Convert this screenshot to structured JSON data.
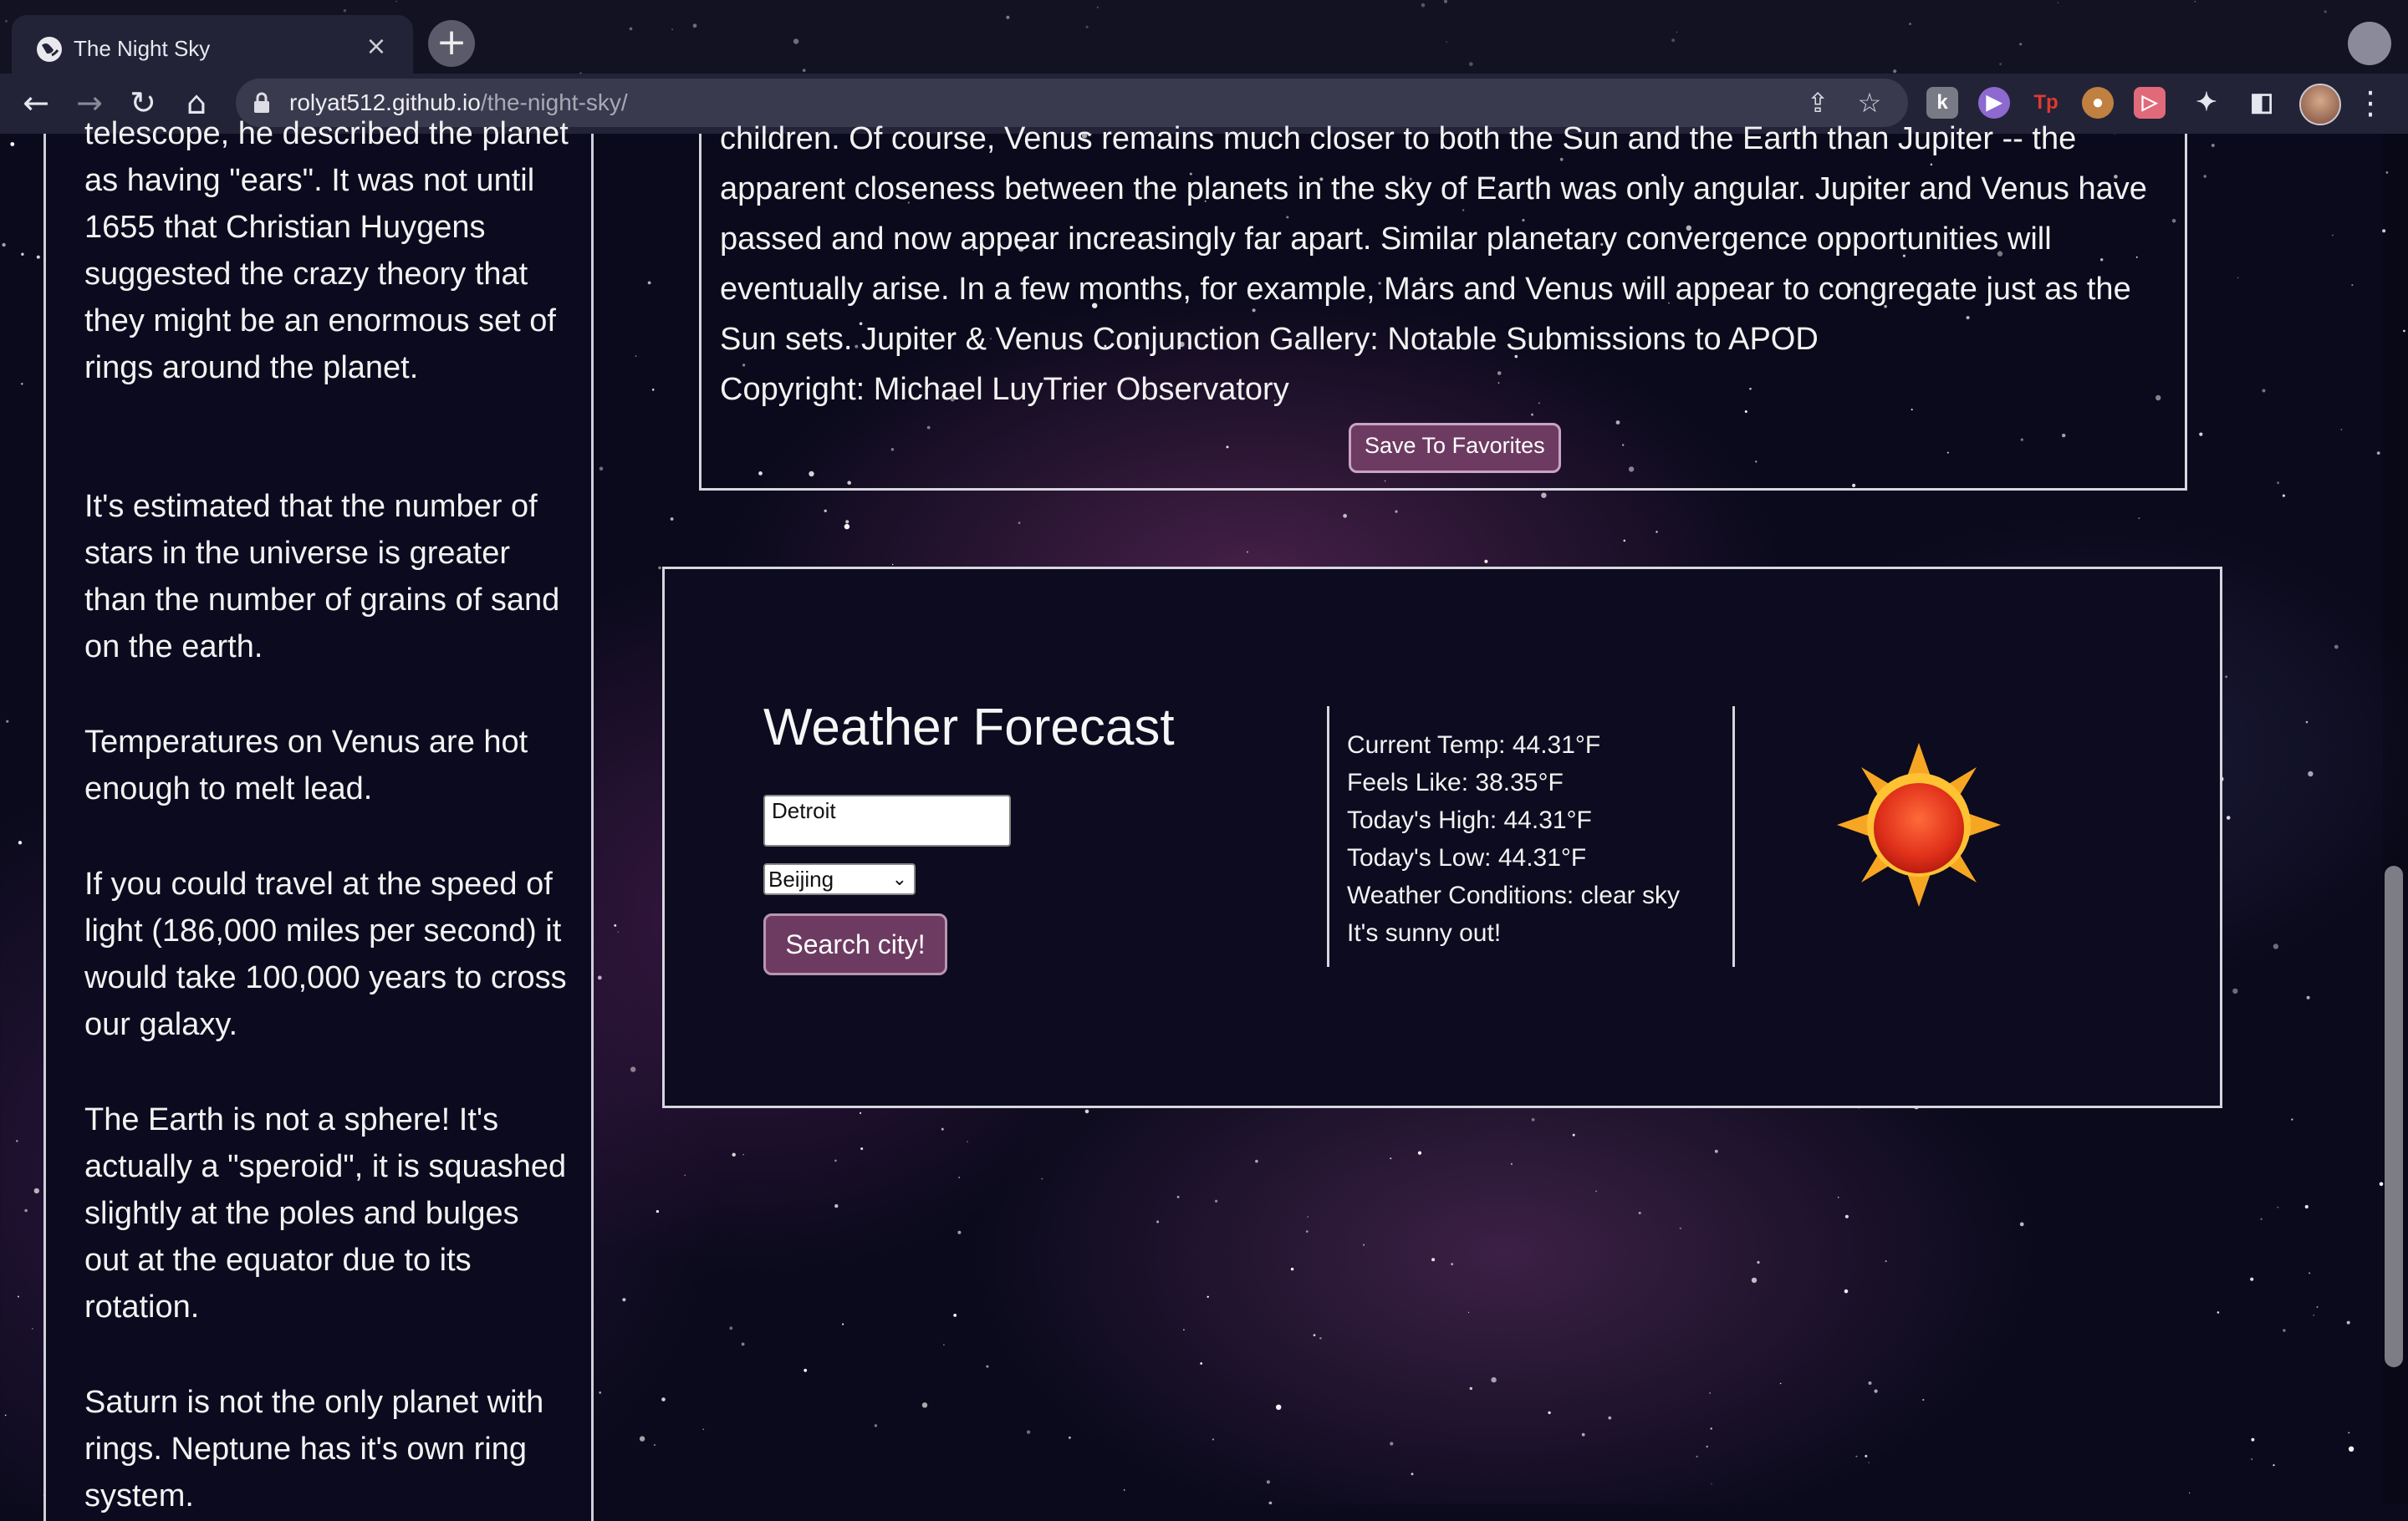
{
  "browser": {
    "tab_title": "The Night Sky",
    "tab_close": "×",
    "new_tab": "+",
    "url_host": "rolyat512.github.io",
    "url_path": "/the-night-sky/"
  },
  "facts": [
    "telescope, he described the planet as having \"ears\". It was not until 1655 that Christian Huygens suggested the crazy theory that they might be an enormous set of rings around the planet.",
    "It's estimated that the number of stars in the universe is greater than the number of grains of sand on the earth.",
    "Temperatures on Venus are hot enough to melt lead.",
    "If you could travel at the speed of light (186,000 miles per second) it would take 100,000 years to cross our galaxy.",
    "The Earth is not a sphere! It's actually a \"speroid\", it is squashed slightly at the poles and bulges out at the equator due to its rotation.",
    "Saturn is not the only planet with rings. Neptune has it's own ring system."
  ],
  "apod": {
    "text": "children. Of course, Venus remains much closer to both the Sun and the Earth than Jupiter -- the apparent closeness between the planets in the sky of Earth was only angular. Jupiter and Venus have passed and now appear increasingly far apart. Similar planetary convergence opportunities will eventually arise. In a few months, for example, Mars and Venus will appear to congregate just as the Sun sets. Jupiter & Venus Conjunction Gallery: Notable Submissions to APOD",
    "copyright": "Copyright: Michael LuyTrier Observatory",
    "favorite_button": "Save To Favorites"
  },
  "weather": {
    "title": "Weather Forecast",
    "city_input_value": "Detroit",
    "city_select_value": "Beijing",
    "search_button": "Search city!",
    "current_temp": "Current Temp: 44.31°F",
    "feels_like": "Feels Like: 38.35°F",
    "high": "Today's High: 44.31°F",
    "low": "Today's Low: 44.31°F",
    "conditions": "Weather Conditions: clear sky",
    "message": "It's sunny out!",
    "icon": "sun-icon"
  },
  "colors": {
    "panel_bg": "#0b0a1e",
    "button_bg": "#6d3b62",
    "border": "#d6d6de"
  }
}
